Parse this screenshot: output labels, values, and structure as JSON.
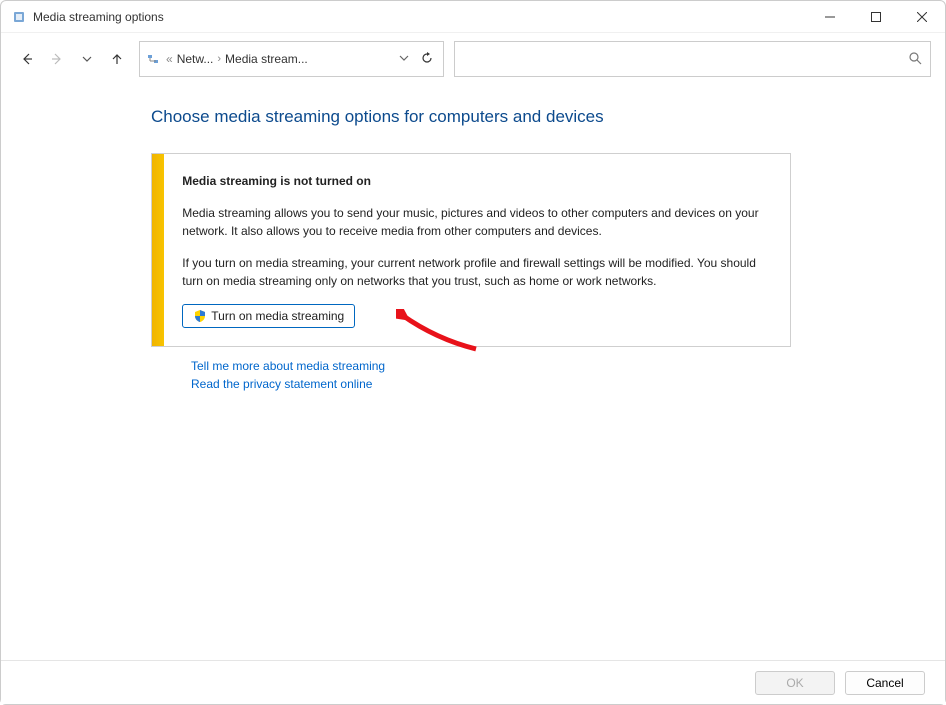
{
  "window": {
    "title": "Media streaming options"
  },
  "breadcrumb": {
    "prefix": "«",
    "seg1": "Netw...",
    "seg2": "Media stream..."
  },
  "page": {
    "heading": "Choose media streaming options for computers and devices"
  },
  "info": {
    "title": "Media streaming is not turned on",
    "p1": "Media streaming allows you to send your music, pictures and videos to other computers and devices on your network.  It also allows you to receive media from other computers and devices.",
    "p2": "If you turn on media streaming, your current network profile and firewall settings will be modified.  You should turn on media streaming only on networks that you trust, such as home or work networks.",
    "button": "Turn on media streaming"
  },
  "links": {
    "more": "Tell me more about media streaming",
    "privacy": "Read the privacy statement online"
  },
  "footer": {
    "ok": "OK",
    "cancel": "Cancel"
  }
}
